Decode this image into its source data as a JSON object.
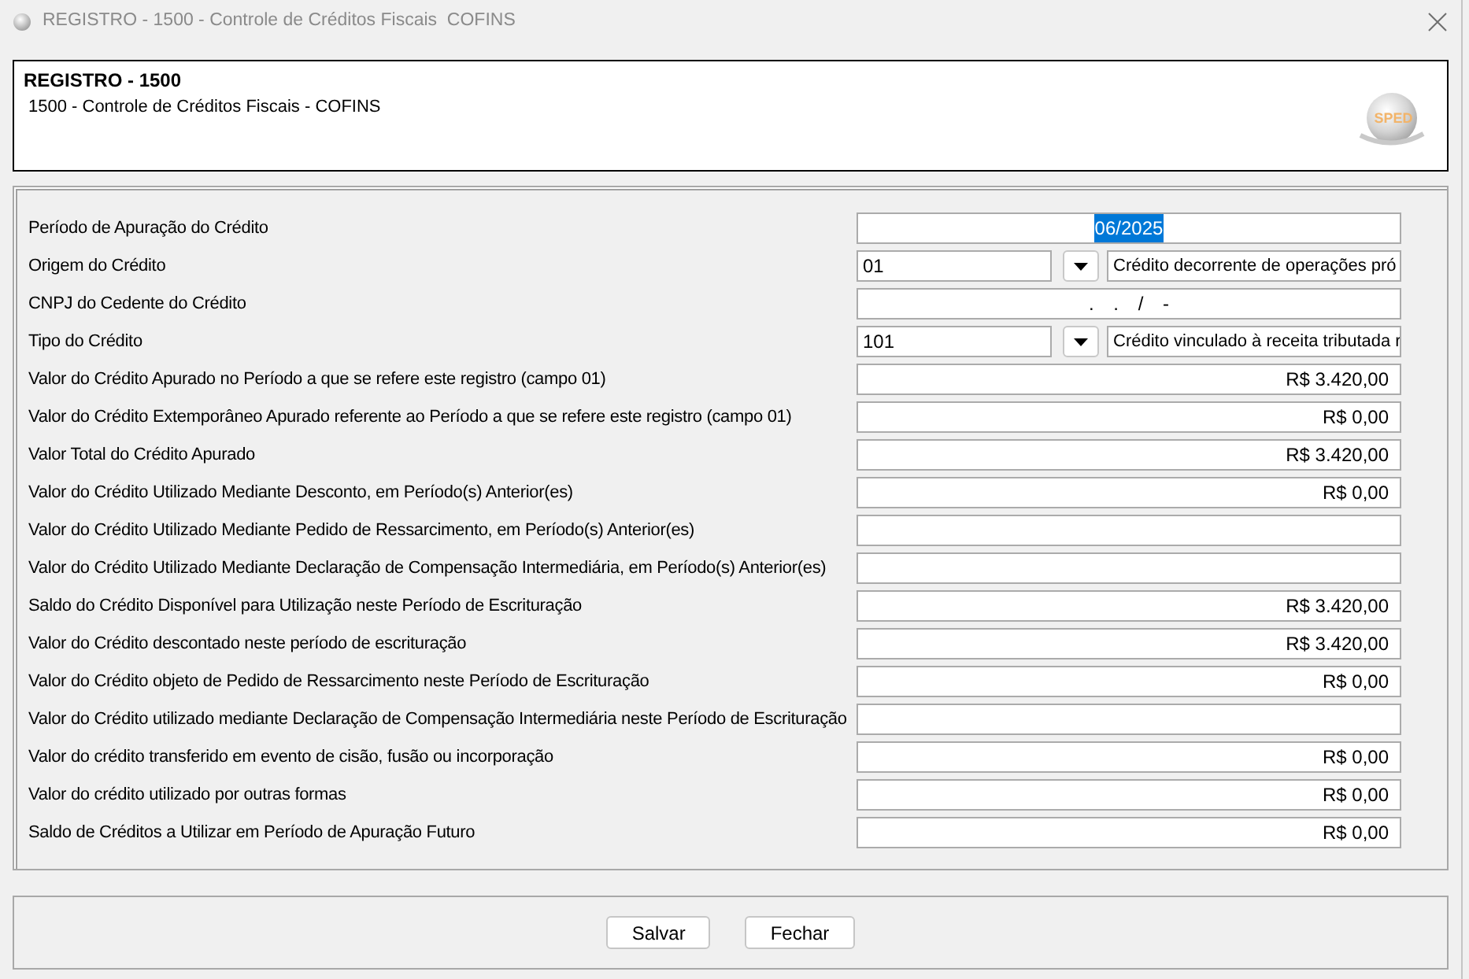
{
  "window": {
    "title": "REGISTRO - 1500 - Controle de Créditos Fiscais  COFINS"
  },
  "header": {
    "title": "REGISTRO - 1500",
    "subtitle": "1500 - Controle de Créditos Fiscais - COFINS",
    "logo_text": "SPED"
  },
  "fields": [
    {
      "label": "Período de Apuração do Crédito",
      "kind": "date",
      "value": "06/2025",
      "text_selected": true
    },
    {
      "label": "Origem do Crédito",
      "kind": "combo",
      "code": "01",
      "description": "Crédito decorrente de operações pró",
      "text_selected": false
    },
    {
      "label": "CNPJ do Cedente do Crédito",
      "kind": "mask",
      "value": ". . / -",
      "text_selected": false
    },
    {
      "label": "Tipo do Crédito",
      "kind": "combo",
      "code": "101",
      "description": "Crédito vinculado à receita tributada r",
      "text_selected": false
    },
    {
      "label": "Valor do Crédito Apurado no Período a que se refere este registro (campo 01)",
      "kind": "money",
      "value": "R$ 3.420,00",
      "text_selected": false
    },
    {
      "label": "Valor do Crédito Extemporâneo Apurado referente ao Período a que se refere este registro (campo 01)",
      "kind": "money",
      "value": "R$ 0,00",
      "text_selected": false
    },
    {
      "label": "Valor Total do Crédito Apurado",
      "kind": "money",
      "value": "R$ 3.420,00",
      "text_selected": false
    },
    {
      "label": "Valor do Crédito Utilizado Mediante Desconto, em Período(s) Anterior(es)",
      "kind": "money",
      "value": "R$ 0,00",
      "text_selected": false
    },
    {
      "label": "Valor do Crédito Utilizado Mediante Pedido de Ressarcimento, em Período(s) Anterior(es)",
      "kind": "money"
    },
    {
      "label": "Valor do Crédito Utilizado Mediante Declaração de Compensação Intermediária, em Período(s) Anterior(es)",
      "kind": "money"
    },
    {
      "label": "Saldo do Crédito Disponível para Utilização neste Período de Escrituração",
      "kind": "money",
      "value": "R$ 3.420,00",
      "text_selected": false
    },
    {
      "label": "Valor do Crédito descontado neste período de escrituração",
      "kind": "money",
      "value": "R$ 3.420,00",
      "text_selected": false
    },
    {
      "label": "Valor do Crédito objeto de Pedido de Ressarcimento neste Período de Escrituração",
      "kind": "money",
      "value": "R$ 0,00",
      "text_selected": false
    },
    {
      "label": "Valor do Crédito utilizado mediante Declaração de Compensação Intermediária neste Período de Escrituração",
      "kind": "money"
    },
    {
      "label": "Valor do crédito transferido em evento de cisão, fusão ou incorporação",
      "kind": "money",
      "value": "R$ 0,00",
      "text_selected": false
    },
    {
      "label": "Valor do crédito utilizado por outras formas",
      "kind": "money",
      "value": "R$ 0,00",
      "text_selected": false
    },
    {
      "label": "Saldo de Créditos a Utilizar em Período de Apuração Futuro",
      "kind": "money",
      "value": "R$ 0,00",
      "text_selected": false
    }
  ],
  "buttons": [
    "Salvar",
    "Fechar"
  ]
}
